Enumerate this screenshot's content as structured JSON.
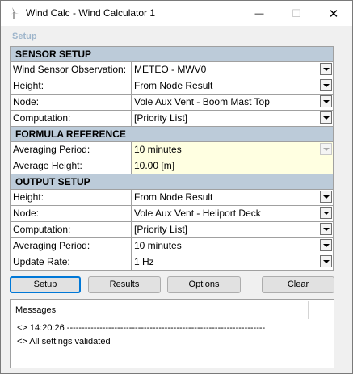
{
  "window": {
    "title": "Wind Calc - Wind Calculator 1",
    "controls": {
      "minimize": "—",
      "maximize": "☐",
      "close": "✕"
    }
  },
  "panel_title": "Setup",
  "sections": {
    "sensor": {
      "title": "SENSOR SETUP",
      "rows": [
        {
          "label": "Wind Sensor Observation:",
          "value": "METEO - MWV0"
        },
        {
          "label": "Height:",
          "value": "From Node Result"
        },
        {
          "label": "Node:",
          "value": "Vole Aux Vent - Boom Mast Top"
        },
        {
          "label": "Computation:",
          "value": "[Priority List]"
        }
      ]
    },
    "formula": {
      "title": "FORMULA REFERENCE",
      "rows": [
        {
          "label": "Averaging Period:",
          "value": "10 minutes"
        },
        {
          "label": "Average Height:",
          "value": "10.00 [m]"
        }
      ]
    },
    "output": {
      "title": "OUTPUT SETUP",
      "rows": [
        {
          "label": "Height:",
          "value": "From Node Result"
        },
        {
          "label": "Node:",
          "value": "Vole Aux Vent - Heliport Deck"
        },
        {
          "label": "Computation:",
          "value": "[Priority List]"
        },
        {
          "label": "Averaging Period:",
          "value": "10 minutes"
        },
        {
          "label": "Update Rate:",
          "value": "1 Hz"
        }
      ]
    }
  },
  "buttons": {
    "setup": "Setup",
    "results": "Results",
    "options": "Options",
    "clear": "Clear"
  },
  "messages": {
    "header": "Messages",
    "lines": [
      "<> 14:20:26 -------------------------------------------------------------------",
      "<> All settings validated"
    ]
  },
  "colors": {
    "section_header": "#bccbd9",
    "setup_label": "#9fb6cc",
    "editable_cell": "#ffffe1",
    "focus_border": "#0078d7"
  }
}
